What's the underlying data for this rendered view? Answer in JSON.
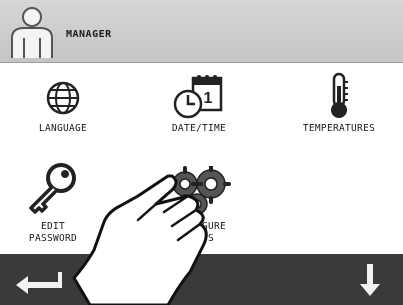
{
  "header": {
    "title": "MANAGER",
    "icon": "user-icon"
  },
  "menu": {
    "language": {
      "label": "LANGUAGE",
      "icon": "globe-icon"
    },
    "datetime": {
      "label": "DATE/TIME",
      "icon": "calendar-clock-icon",
      "calendar_day": "1"
    },
    "temperatures": {
      "label": "TEMPERATURES",
      "icon": "thermometer-icon"
    },
    "edit_password": {
      "label_line1": "EDIT",
      "label_line2": "PASSWORD",
      "icon": "key-icon"
    },
    "configure_slots": {
      "label_line1": "CONFIGURE",
      "label_line2": "SLOTS",
      "icon": "gears-icon"
    }
  },
  "footer": {
    "back": "back-arrow-icon",
    "down": "down-arrow-icon"
  },
  "overlay": {
    "icon": "pointing-hand-icon"
  },
  "colors": {
    "header_bg": "#cfcfcf",
    "footer_bg": "#3a3a3a",
    "icon_fill": "#222222"
  }
}
